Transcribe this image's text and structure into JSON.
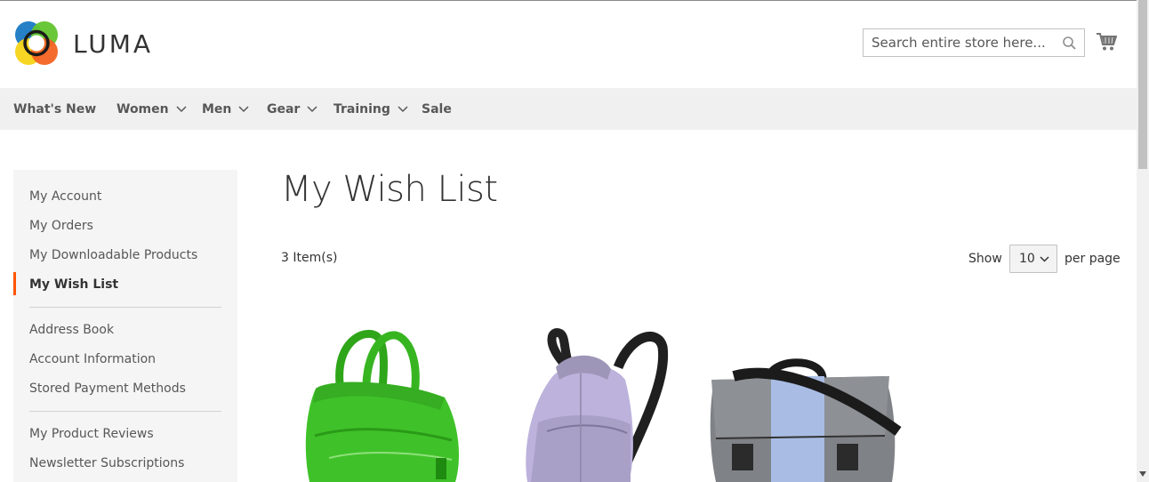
{
  "header": {
    "logo_text": "LUMA",
    "search_placeholder": "Search entire store here...",
    "cart_icon": "shopping-cart-icon"
  },
  "nav": {
    "items": [
      {
        "label": "What's New",
        "has_dropdown": false
      },
      {
        "label": "Women",
        "has_dropdown": true
      },
      {
        "label": "Men",
        "has_dropdown": true
      },
      {
        "label": "Gear",
        "has_dropdown": true
      },
      {
        "label": "Training",
        "has_dropdown": true
      },
      {
        "label": "Sale",
        "has_dropdown": false
      }
    ]
  },
  "sidebar": {
    "items": [
      {
        "label": "My Account"
      },
      {
        "label": "My Orders"
      },
      {
        "label": "My Downloadable Products"
      },
      {
        "label": "My Wish List",
        "active": true
      },
      {
        "label": "Address Book"
      },
      {
        "label": "Account Information"
      },
      {
        "label": "Stored Payment Methods"
      },
      {
        "label": "My Product Reviews"
      },
      {
        "label": "Newsletter Subscriptions"
      }
    ]
  },
  "main": {
    "title": "My Wish List",
    "item_count": "3 Item(s)",
    "show_label": "Show",
    "limiter_value": "10",
    "per_page_label": "per page",
    "products": [
      {
        "image": "green-duffle-bag"
      },
      {
        "image": "lavender-backpack"
      },
      {
        "image": "gray-messenger-bag"
      }
    ]
  },
  "colors": {
    "accent": "#ff5501",
    "nav_bg": "#f0f0f0",
    "sidebar_bg": "#f5f5f5"
  }
}
